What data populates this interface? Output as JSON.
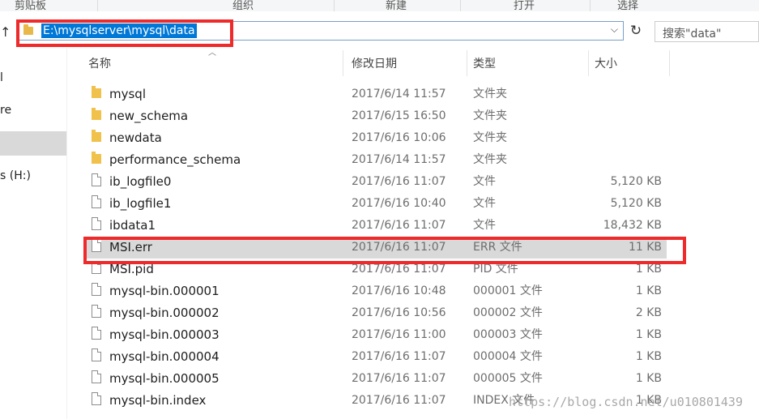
{
  "ribbon": {
    "groups": [
      "剪贴板",
      "组织",
      "新建",
      "打开",
      "选择"
    ]
  },
  "address_bar": {
    "path": "E:\\mysqlserver\\mysql\\data",
    "dropdown_icon": "chevron-down-icon"
  },
  "search": {
    "placeholder": "搜索\"data\""
  },
  "nav_pane": {
    "items": [
      "l",
      "re",
      "s (H:)"
    ]
  },
  "columns": {
    "name": "名称",
    "date": "修改日期",
    "type": "类型",
    "size": "大小"
  },
  "files": [
    {
      "name": "mysql",
      "date": "2017/6/14 11:57",
      "type": "文件夹",
      "size": "",
      "icon": "folder-icon"
    },
    {
      "name": "new_schema",
      "date": "2017/6/15 16:50",
      "type": "文件夹",
      "size": "",
      "icon": "folder-icon"
    },
    {
      "name": "newdata",
      "date": "2017/6/16 10:06",
      "type": "文件夹",
      "size": "",
      "icon": "folder-icon"
    },
    {
      "name": "performance_schema",
      "date": "2017/6/14 11:57",
      "type": "文件夹",
      "size": "",
      "icon": "folder-icon"
    },
    {
      "name": "ib_logfile0",
      "date": "2017/6/16 11:07",
      "type": "文件",
      "size": "5,120 KB",
      "icon": "file-icon"
    },
    {
      "name": "ib_logfile1",
      "date": "2017/6/16 10:40",
      "type": "文件",
      "size": "5,120 KB",
      "icon": "file-icon"
    },
    {
      "name": "ibdata1",
      "date": "2017/6/16 11:07",
      "type": "文件",
      "size": "18,432 KB",
      "icon": "file-icon"
    },
    {
      "name": "MSI.err",
      "date": "2017/6/16 11:07",
      "type": "ERR 文件",
      "size": "11 KB",
      "icon": "file-icon",
      "selected": true
    },
    {
      "name": "MSI.pid",
      "date": "2017/6/16 11:07",
      "type": "PID 文件",
      "size": "1 KB",
      "icon": "file-icon"
    },
    {
      "name": "mysql-bin.000001",
      "date": "2017/6/16 10:48",
      "type": "000001 文件",
      "size": "1 KB",
      "icon": "file-icon"
    },
    {
      "name": "mysql-bin.000002",
      "date": "2017/6/16 10:56",
      "type": "000002 文件",
      "size": "2 KB",
      "icon": "file-icon"
    },
    {
      "name": "mysql-bin.000003",
      "date": "2017/6/16 11:00",
      "type": "000003 文件",
      "size": "1 KB",
      "icon": "file-icon"
    },
    {
      "name": "mysql-bin.000004",
      "date": "2017/6/16 11:07",
      "type": "000004 文件",
      "size": "1 KB",
      "icon": "file-icon"
    },
    {
      "name": "mysql-bin.000005",
      "date": "2017/6/16 11:07",
      "type": "000005 文件",
      "size": "1 KB",
      "icon": "file-icon"
    },
    {
      "name": "mysql-bin.index",
      "date": "2017/6/16 11:07",
      "type": "INDEX 文件",
      "size": "1 KB",
      "icon": "file-icon"
    }
  ],
  "watermark": "https://blog.csdn.net/u010801439",
  "colors": {
    "annotation_red": "#ee2a2a",
    "selection_blue": "#0078d7",
    "row_selected": "#d9d9d9"
  }
}
